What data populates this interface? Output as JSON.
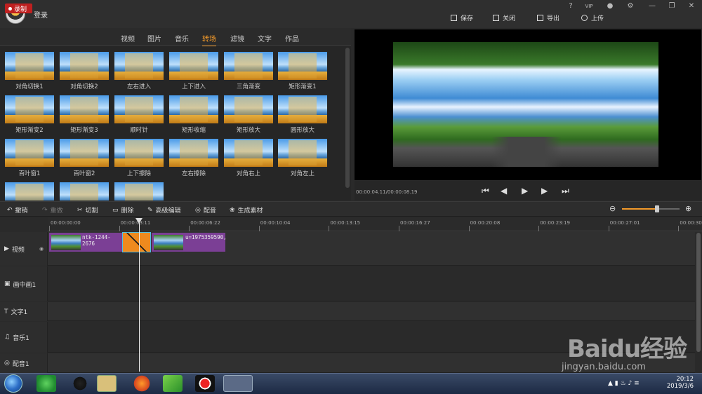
{
  "header": {
    "login": "登录",
    "window_icons": [
      "?",
      "VIP",
      "bell",
      "gear",
      "minimize",
      "restore",
      "close"
    ],
    "actions": [
      {
        "label": "保存",
        "icon": "save-icon"
      },
      {
        "label": "关闭",
        "icon": "close-doc-icon"
      },
      {
        "label": "导出",
        "icon": "export-icon"
      },
      {
        "label": "上传",
        "icon": "upload-icon"
      }
    ]
  },
  "menu": {
    "record": "录制",
    "tabs": [
      "视频",
      "图片",
      "音乐",
      "转场",
      "滤镜",
      "文字",
      "作品"
    ],
    "active_tab": "转场"
  },
  "transitions": [
    "对角切换1",
    "对角切换2",
    "左右进入",
    "上下进入",
    "三角渐变",
    "矩形渐变1",
    "矩形渐变2",
    "矩形渐变3",
    "顺时针",
    "矩形收缩",
    "矩形放大",
    "圆形放大",
    "百叶窗1",
    "百叶窗2",
    "上下擦除",
    "左右擦除",
    "对角右上",
    "对角左上",
    "",
    "",
    ""
  ],
  "preview": {
    "time": "00:00:04.11/00:00:08.19"
  },
  "edit_toolbar": {
    "items": [
      {
        "label": "撤销",
        "enabled": true
      },
      {
        "label": "重做",
        "enabled": false
      },
      {
        "label": "切割",
        "enabled": true
      },
      {
        "label": "删除",
        "enabled": true
      },
      {
        "label": "高级编辑",
        "enabled": true
      },
      {
        "label": "配音",
        "enabled": true
      },
      {
        "label": "生成素材",
        "enabled": true
      }
    ],
    "zoom_level": 0.61
  },
  "ruler": [
    "00:00:00:00",
    "00:00:03:11",
    "00:00:06:22",
    "00:00:10:04",
    "00:00:13:15",
    "00:00:16:27",
    "00:00:20:08",
    "00:00:23:19",
    "00:00:27:01",
    "00:00:30"
  ],
  "tracks": [
    {
      "name": "视频"
    },
    {
      "name": "画中画1"
    },
    {
      "name": "文字1"
    },
    {
      "name": "音乐1"
    },
    {
      "name": "配音1"
    }
  ],
  "clips": {
    "clip1_label": "ntk-1244-2676",
    "clip2_label": "u=1975359590,"
  },
  "taskbar": {
    "time": "20:12",
    "date": "2019/3/6"
  },
  "watermark": {
    "brand": "Baidu经验",
    "url": "jingyan.baidu.com"
  }
}
